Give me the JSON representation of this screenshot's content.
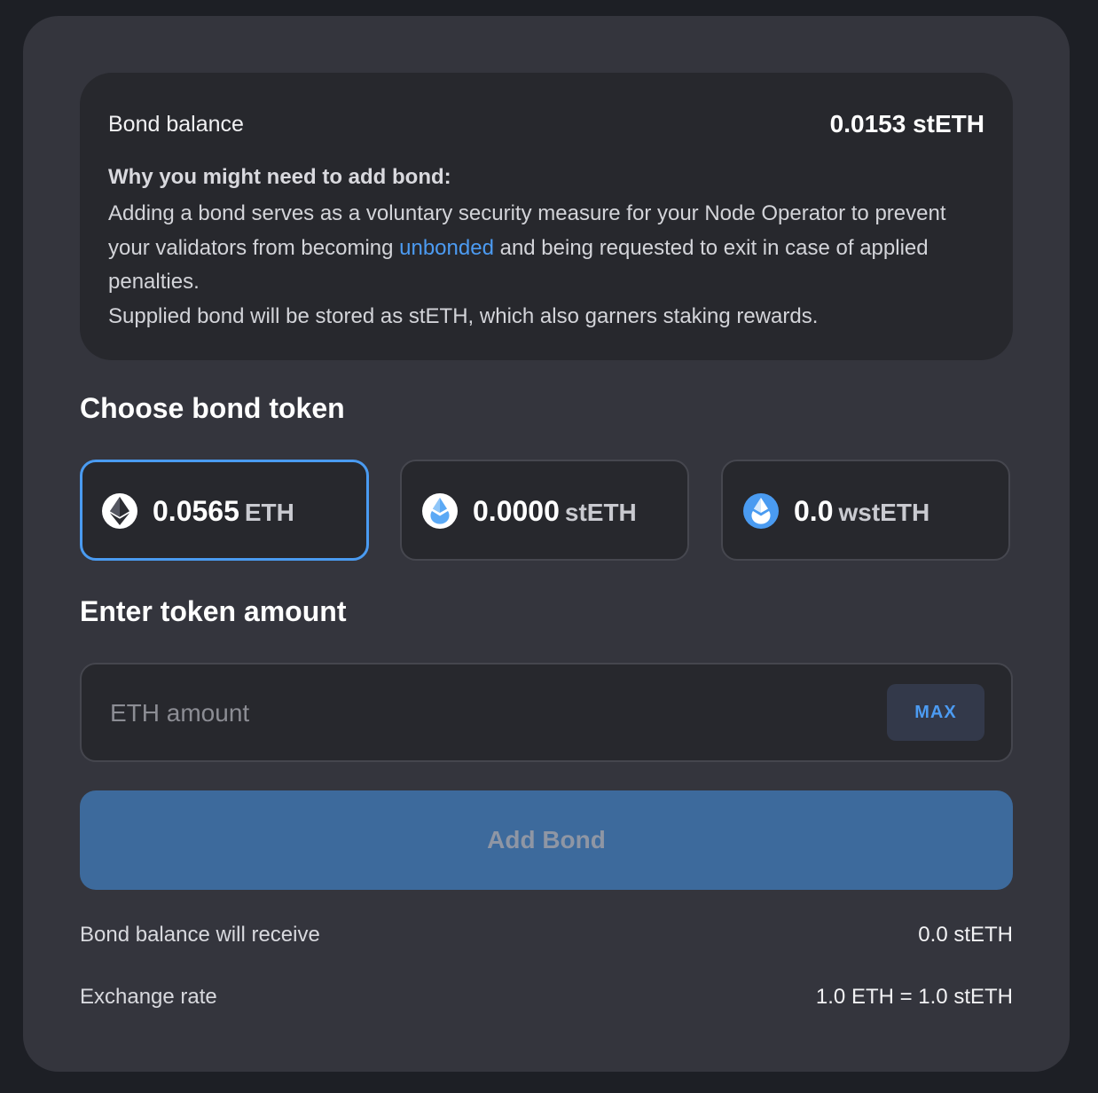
{
  "bond_info": {
    "balance_label": "Bond balance",
    "balance_value": "0.0153 stETH",
    "why_title": "Why you might need to add bond:",
    "why_text_part1": "Adding a bond serves as a voluntary security measure for your Node Operator to prevent your validators from becoming ",
    "why_link": "unbonded",
    "why_text_part2": " and being requested to exit in case of applied penalties.",
    "why_text_line2": "Supplied bond will be stored as stETH, which also garners staking rewards."
  },
  "choose_token": {
    "title": "Choose bond token",
    "tokens": [
      {
        "amount": "0.0565",
        "symbol": "ETH",
        "icon": "eth-icon",
        "selected": true
      },
      {
        "amount": "0.0000",
        "symbol": "stETH",
        "icon": "steth-icon",
        "selected": false
      },
      {
        "amount": "0.0",
        "symbol": "wstETH",
        "icon": "wsteth-icon",
        "selected": false
      }
    ]
  },
  "amount": {
    "title": "Enter token amount",
    "placeholder": "ETH amount",
    "value": "",
    "max_label": "MAX"
  },
  "submit": {
    "label": "Add Bond",
    "color": "#3d6a9c"
  },
  "summary": [
    {
      "label": "Bond balance will receive",
      "value": "0.0 stETH"
    },
    {
      "label": "Exchange rate",
      "value": "1.0 ETH = 1.0 stETH"
    }
  ],
  "colors": {
    "accent": "#4a9bf1",
    "link": "#4c9bf2",
    "card_bg": "#34353d",
    "panel_bg": "#27282d"
  }
}
